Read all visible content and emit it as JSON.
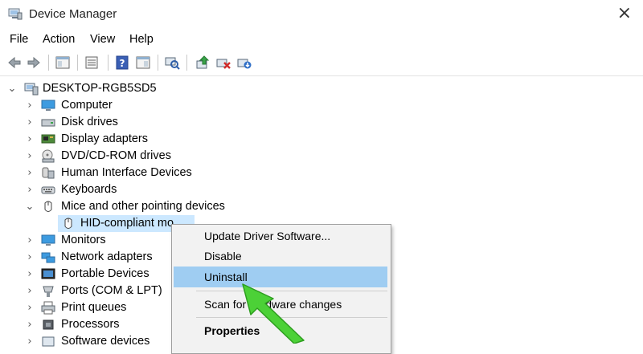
{
  "window": {
    "title": "Device Manager",
    "close_glyph": "×"
  },
  "menu": [
    "File",
    "Action",
    "View",
    "Help"
  ],
  "toolbar": {
    "buttons": [
      "back-icon",
      "forward-icon",
      "properties-pane-icon",
      "show-hidden-icon",
      "help-icon",
      "action-view-icon",
      "scan-hardware-icon",
      "update-driver-icon",
      "uninstall-device-icon",
      "add-legacy-icon"
    ]
  },
  "tree": {
    "root": "DESKTOP-RGB5SD5",
    "items": [
      {
        "label": "Computer",
        "icon": "computer-icon",
        "expanded": false
      },
      {
        "label": "Disk drives",
        "icon": "disk-drive-icon",
        "expanded": false
      },
      {
        "label": "Display adapters",
        "icon": "display-adapter-icon",
        "expanded": false
      },
      {
        "label": "DVD/CD-ROM drives",
        "icon": "dvd-drive-icon",
        "expanded": false
      },
      {
        "label": "Human Interface Devices",
        "icon": "hid-icon",
        "expanded": false
      },
      {
        "label": "Keyboards",
        "icon": "keyboard-icon",
        "expanded": false
      },
      {
        "label": "Mice and other pointing devices",
        "icon": "mouse-icon",
        "expanded": true
      },
      {
        "label": "HID-compliant mo",
        "icon": "mouse-icon",
        "child": true,
        "selected": true
      },
      {
        "label": "Monitors",
        "icon": "monitor-icon",
        "expanded": false
      },
      {
        "label": "Network adapters",
        "icon": "network-adapter-icon",
        "expanded": false
      },
      {
        "label": "Portable Devices",
        "icon": "portable-device-icon",
        "expanded": false
      },
      {
        "label": "Ports (COM & LPT)",
        "icon": "port-icon",
        "expanded": false
      },
      {
        "label": "Print queues",
        "icon": "printer-icon",
        "expanded": false
      },
      {
        "label": "Processors",
        "icon": "processor-icon",
        "expanded": false
      },
      {
        "label": "Software devices",
        "icon": "software-device-icon",
        "expanded": false
      }
    ]
  },
  "context_menu": {
    "items": [
      {
        "label": "Update Driver Software..."
      },
      {
        "label": "Disable"
      },
      {
        "label": "Uninstall",
        "highlighted": true
      },
      {
        "label": "Scan for hardware changes"
      },
      {
        "label": "Properties",
        "bold": true
      }
    ]
  },
  "colors": {
    "selection": "#cce8ff",
    "menu_highlight": "#9fcdf2",
    "arrow": "#4cd137"
  }
}
